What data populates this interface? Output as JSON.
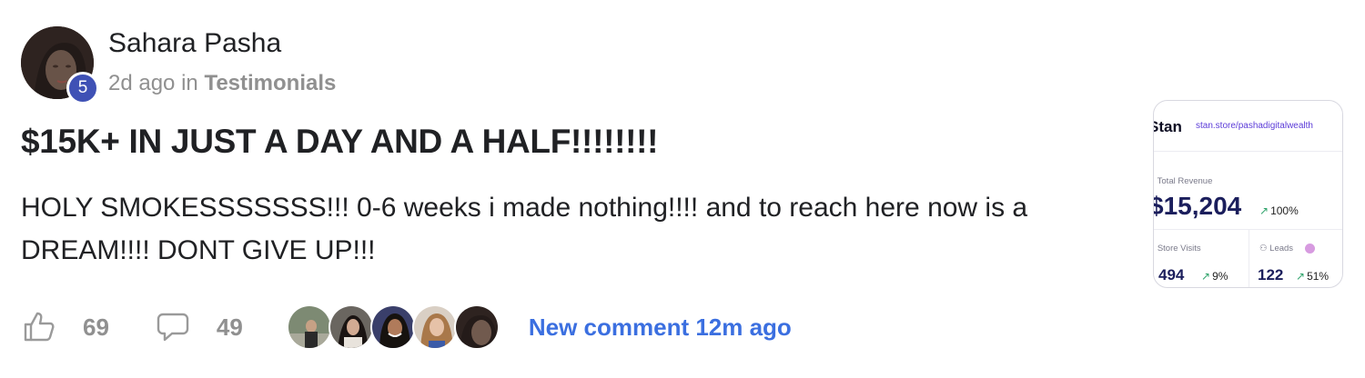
{
  "post": {
    "author": "Sahara Pasha",
    "level": "5",
    "time_ago": "2d ago",
    "in_word": "in",
    "category": "Testimonials",
    "title": "$15K+ IN JUST A DAY AND A HALF!!!!!!!!",
    "body": "HOLY SMOKESSSSSSS!!! 0-6 weeks i made nothing!!!! and to reach here now is a DREAM!!!! DONT GIVE UP!!!"
  },
  "actions": {
    "likes": "69",
    "comments": "49",
    "new_comment": "New comment 12m ago"
  },
  "stan_card": {
    "logo": "Stan",
    "url": "stan.store/pashadigitalwealth",
    "total_revenue_label": "Total Revenue",
    "total_revenue": "$15,204",
    "total_revenue_change": "100%",
    "store_visits_label": "Store Visits",
    "store_visits": "494",
    "store_visits_change": "9%",
    "leads_label": "Leads",
    "leads": "122",
    "leads_change": "51%"
  },
  "colors": {
    "accent_link": "#3b6fe0",
    "level_badge": "#3f51b5",
    "muted_text": "#909090",
    "stan_navy": "#1b1e5c",
    "stan_purple": "#5b3bd8",
    "trend_green": "#2fa36b"
  }
}
